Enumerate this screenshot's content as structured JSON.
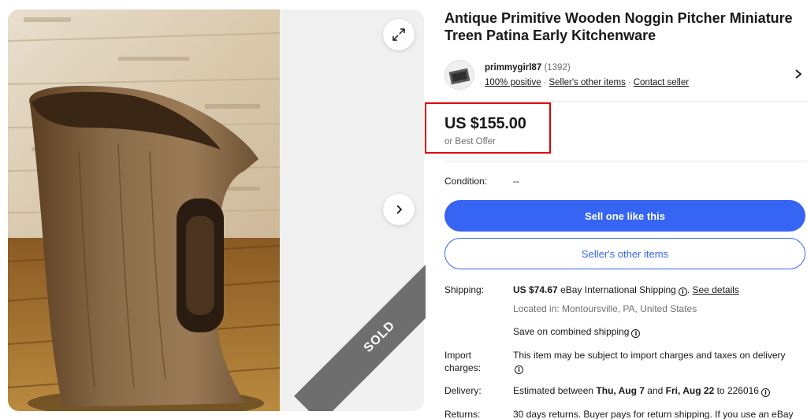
{
  "listing": {
    "title": "Antique Primitive Wooden Noggin Pitcher Miniature Treen Patina Early Kitchenware",
    "sold_label": "SOLD"
  },
  "seller": {
    "name": "primmygirl87",
    "feedback_count": "(1392)",
    "positive": "100% positive",
    "other_items": "Seller's other items",
    "contact": "Contact seller",
    "separator": "·"
  },
  "price": {
    "amount": "US $155.00",
    "best_offer": "or Best Offer"
  },
  "condition": {
    "label": "Condition:",
    "value": "--"
  },
  "buttons": {
    "sell_one": "Sell one like this",
    "sellers_other": "Seller's other items"
  },
  "shipping": {
    "label": "Shipping:",
    "cost": "US $74.67",
    "method": "eBay International Shipping",
    "period": ".",
    "details_link": "See details",
    "location": "Located in: Montoursville, PA, United States",
    "combined": "Save on combined shipping"
  },
  "import": {
    "label_line1": "Import",
    "label_line2": "charges:",
    "text": "This item may be subject to import charges and taxes on delivery"
  },
  "delivery": {
    "label": "Delivery:",
    "prefix": "Estimated between",
    "start": "Thu, Aug 7",
    "and": "and",
    "end": "Fri, Aug 22",
    "to": "to 226016"
  },
  "returns": {
    "label": "Returns:",
    "text": "30 days returns. Buyer pays for return shipping. If you use an eBay"
  },
  "icons": {
    "info": "i",
    "expand": "expand-icon",
    "next": "chevron-right-icon"
  },
  "colors": {
    "primary": "#3665f3",
    "highlight": "#e10000",
    "sold_ribbon": "#6e6e6e"
  }
}
